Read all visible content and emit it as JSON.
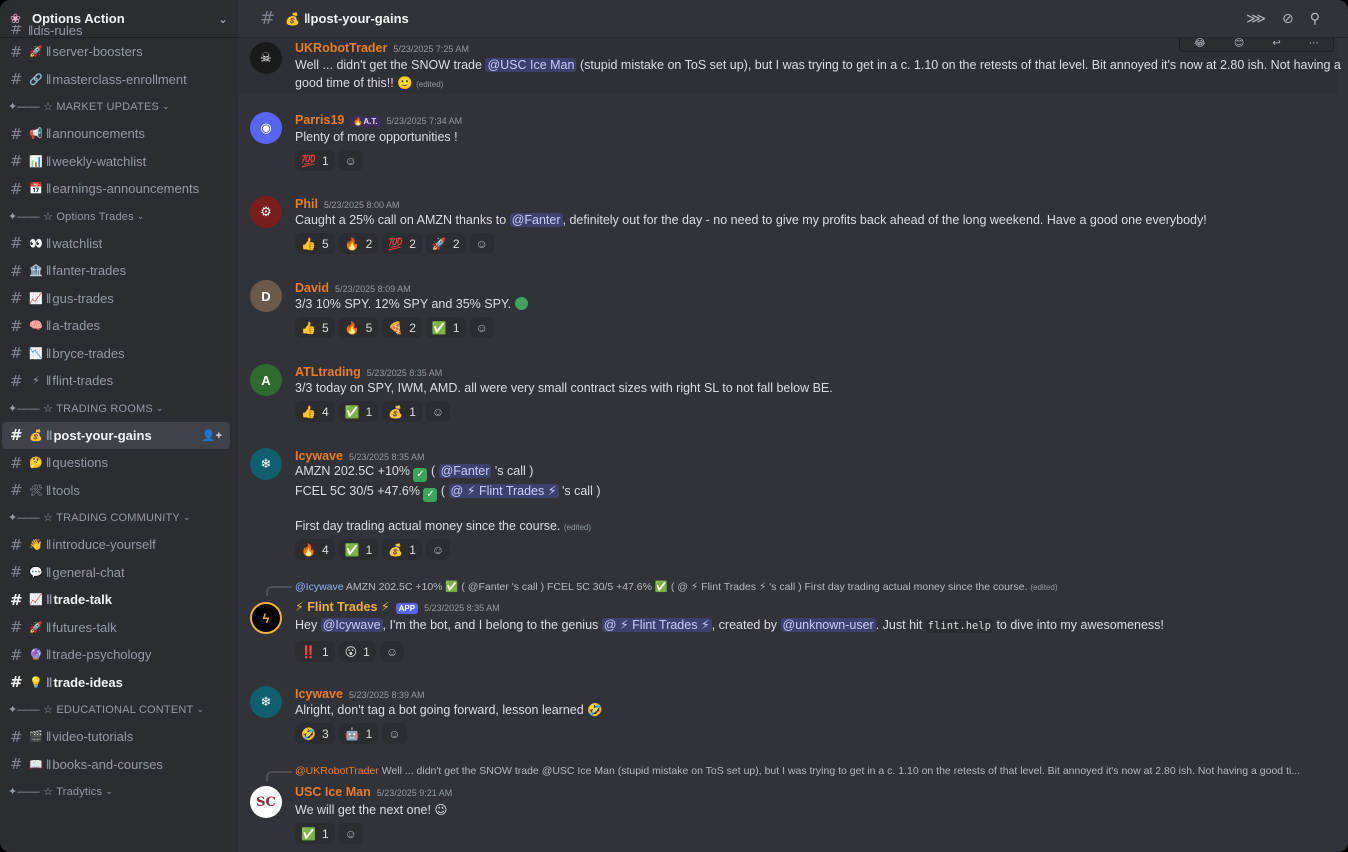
{
  "server": {
    "name": "Options Action"
  },
  "channel_header": {
    "name": "post-your-gains",
    "emoji": "💰"
  },
  "sidebar": {
    "top_partial": "‖dis-rules",
    "items": [
      {
        "type": "chan",
        "emoji": "🚀",
        "label": "server-boosters"
      },
      {
        "type": "chan",
        "emoji": "🔗",
        "label": "masterclass-enrollment"
      },
      {
        "type": "cat",
        "label": "✦—— ☆ MARKET UPDATES"
      },
      {
        "type": "chan",
        "emoji": "📢",
        "label": "announcements"
      },
      {
        "type": "chan",
        "emoji": "📊",
        "label": "weekly-watchlist"
      },
      {
        "type": "chan",
        "emoji": "📅",
        "label": "earnings-announcements"
      },
      {
        "type": "cat",
        "label": "✦—— ☆ Options Trades"
      },
      {
        "type": "chan",
        "emoji": "👀",
        "label": "watchlist"
      },
      {
        "type": "chan",
        "emoji": "🏦",
        "label": "fanter-trades"
      },
      {
        "type": "chan",
        "emoji": "📈",
        "label": "gus-trades"
      },
      {
        "type": "chan",
        "emoji": "🧠",
        "label": "a-trades"
      },
      {
        "type": "chan",
        "emoji": "📉",
        "label": "bryce-trades"
      },
      {
        "type": "chan",
        "emoji": "⚡",
        "label": "flint-trades"
      },
      {
        "type": "cat",
        "label": "✦—— ☆ TRADING ROOMS"
      },
      {
        "type": "chan",
        "emoji": "💰",
        "label": "post-your-gains",
        "state": "active"
      },
      {
        "type": "chan",
        "emoji": "🤔",
        "label": "questions"
      },
      {
        "type": "chan",
        "emoji": "🛠",
        "label": "tools"
      },
      {
        "type": "cat",
        "label": "✦—— ☆ TRADING COMMUNITY"
      },
      {
        "type": "chan",
        "emoji": "👋",
        "label": "introduce-yourself"
      },
      {
        "type": "chan",
        "emoji": "💬",
        "label": "general-chat"
      },
      {
        "type": "chan",
        "emoji": "📈",
        "label": "trade-talk",
        "state": "unread"
      },
      {
        "type": "chan",
        "emoji": "🚀",
        "label": "futures-talk"
      },
      {
        "type": "chan",
        "emoji": "🔮",
        "label": "trade-psychology"
      },
      {
        "type": "chan",
        "emoji": "💡",
        "label": "trade-ideas",
        "state": "unread"
      },
      {
        "type": "cat",
        "label": "✦—— ☆ EDUCATIONAL CONTENT"
      },
      {
        "type": "chan",
        "emoji": "🎬",
        "label": "video-tutorials"
      },
      {
        "type": "chan",
        "emoji": "📖",
        "label": "books-and-courses"
      },
      {
        "type": "cat",
        "label": "✦—— ☆ Tradytics"
      }
    ]
  },
  "messages": {
    "m1": {
      "user": "UKRobotTrader",
      "time": "5/23/2025 7:25 AM",
      "line1_a": "Well ... didn't get the SNOW trade ",
      "mention": "@USC Ice Man",
      "line1_b": " (stupid mistake on ToS set up), but I was trying to get in a c. 1.10 on the retests of that level.  Bit annoyed it's now at 2.80 ish.  Not having a",
      "line2": "good time of this!! 🙂",
      "edited": "(edited)"
    },
    "m2": {
      "user": "Parris19",
      "tag": "🔥A.T.",
      "time": "5/23/2025 7:34 AM",
      "text": "Plenty of more opportunities !",
      "reactions": [
        {
          "emoji": "💯",
          "count": "1"
        }
      ]
    },
    "m3": {
      "user": "Phil",
      "time": "5/23/2025 8:00 AM",
      "text_a": "Caught a 25% call on AMZN thanks to ",
      "mention": "@Fanter",
      "text_b": ", definitely out for the day - no need to give my profits back ahead of the long weekend. Have a good one everybody!",
      "reactions": [
        {
          "emoji": "👍",
          "count": "5"
        },
        {
          "emoji": "🔥",
          "count": "2"
        },
        {
          "emoji": "💯",
          "count": "2"
        },
        {
          "emoji": "🚀",
          "count": "2"
        }
      ]
    },
    "m4": {
      "user": "David",
      "time": "5/23/2025 8:09 AM",
      "text": "3/3 10% SPY. 12% SPY and 35% SPY. ",
      "reactions": [
        {
          "emoji": "👍",
          "count": "5"
        },
        {
          "emoji": "🔥",
          "count": "5"
        },
        {
          "emoji": "🍕",
          "count": "2"
        },
        {
          "emoji": "✅",
          "count": "1"
        }
      ]
    },
    "m5": {
      "user": "ATLtrading",
      "time": "5/23/2025 8:35 AM",
      "text": "3/3 today on SPY, IWM, AMD.  all were very small contract sizes with right SL to not fall below BE.",
      "reactions": [
        {
          "emoji": "👍",
          "count": "4"
        },
        {
          "emoji": "✅",
          "count": "1"
        },
        {
          "emoji": "💰",
          "count": "1"
        }
      ]
    },
    "m6": {
      "user": "Icywave",
      "time": "5/23/2025 8:35 AM",
      "l1_a": "AMZN 202.5C +10% ",
      "l1_b": " ( ",
      "l1_mention": "@Fanter",
      "l1_c": " 's call )",
      "l2_a": "FCEL 5C 30/5 +47.6% ",
      "l2_b": " ( ",
      "l2_mention": "@ ⚡ Flint Trades ⚡",
      "l2_c": " 's call )",
      "l3": "First day trading actual money since the course. ",
      "edited": "(edited)",
      "reactions": [
        {
          "emoji": "🔥",
          "count": "4"
        },
        {
          "emoji": "✅",
          "count": "1"
        },
        {
          "emoji": "💰",
          "count": "1"
        }
      ]
    },
    "m7": {
      "reply_user": "@Icywave",
      "reply_text": " AMZN 202.5C +10% ✅ ( @Fanter 's call ) FCEL 5C 30/5 +47.6% ✅ ( @ ⚡ Flint Trades ⚡ 's call )  First day trading actual money since the course. ",
      "reply_edited": "(edited)",
      "user": "⚡ Flint Trades ⚡",
      "tag": "APP",
      "time": "5/23/2025 8:35 AM",
      "text_a": "Hey ",
      "mention1": "@Icywave",
      "text_b": ", I'm the bot, and I belong to the genius ",
      "mention2": "@ ⚡ Flint Trades ⚡",
      "text_c": ", created by ",
      "mention3": "@unknown-user",
      "text_d": ". Just hit ",
      "code": "flint.help",
      "text_e": " to dive into my awesomeness!",
      "reactions": [
        {
          "emoji": "‼️",
          "count": "1"
        },
        {
          "emoji": "😮",
          "count": "1"
        }
      ]
    },
    "m8": {
      "user": "Icywave",
      "time": "5/23/2025 8:39 AM",
      "text": "Alright, don't tag a bot going forward, lesson learned 🤣",
      "reactions": [
        {
          "emoji": "🤣",
          "count": "3"
        },
        {
          "emoji": "🤖",
          "count": "1"
        }
      ]
    },
    "m9": {
      "reply_user": "@UKRobotTrader",
      "reply_text": " Well ... didn't get the SNOW trade @USC Ice Man (stupid mistake on ToS set up), but I was trying to get in a c. 1.10 on the retests of that level.  Bit annoyed it's now at 2.80 ish.  Not having a good ti...",
      "user": "USC Ice Man",
      "time": "5/23/2025 9:21 AM",
      "text": "We will get the next one! 😉",
      "reactions": [
        {
          "emoji": "✅",
          "count": "1"
        }
      ]
    }
  },
  "colors": {
    "orange_user": "#e67e22",
    "bot_user": "#f0b232",
    "mention_bg": "#3c4270",
    "accent": "#5865f2"
  },
  "icons": [
    "threads-icon",
    "mute-icon",
    "pin-icon",
    "add-reaction-icon",
    "hash-icon",
    "chevron-down-icon",
    "add-member-icon"
  ]
}
